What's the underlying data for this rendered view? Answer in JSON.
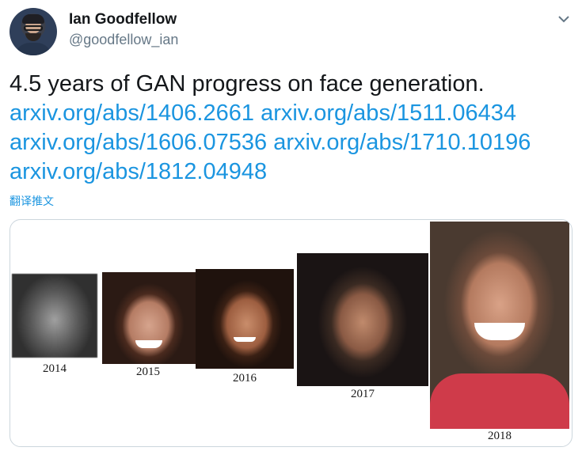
{
  "user": {
    "display_name": "Ian Goodfellow",
    "handle": "@goodfellow_ian"
  },
  "icons": {
    "menu_caret": "chevron-down-icon"
  },
  "tweet": {
    "text": "4.5 years of GAN progress on face generation.",
    "links": [
      "arxiv.org/abs/1406.2661",
      "arxiv.org/abs/1511.06434",
      "arxiv.org/abs/1606.07536",
      "arxiv.org/abs/1710.10196",
      "arxiv.org/abs/1812.04948"
    ],
    "translate_label": "翻译推文"
  },
  "media": {
    "years": [
      "2014",
      "2015",
      "2016",
      "2017",
      "2018"
    ]
  },
  "colors": {
    "link": "#1b95e0",
    "secondary_text": "#657786",
    "border": "#ccd6dd"
  }
}
